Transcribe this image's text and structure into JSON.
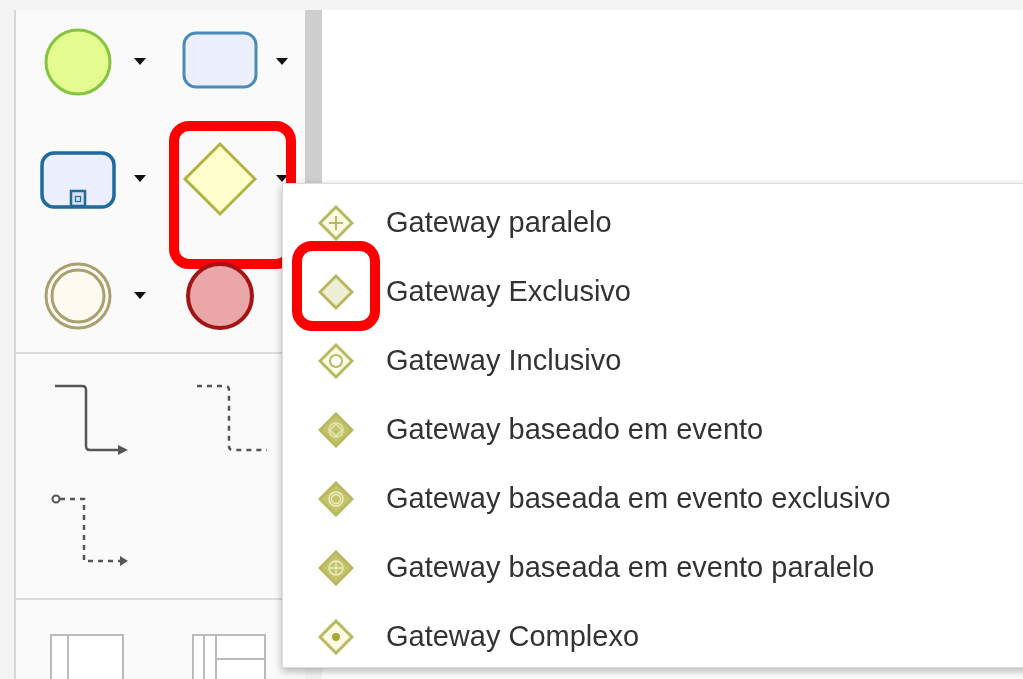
{
  "palette": {
    "sections": [
      {
        "tools": [
          {
            "kind": "start-event",
            "has_menu": true
          },
          {
            "kind": "task",
            "has_menu": true
          },
          {
            "kind": "subprocess",
            "has_menu": true
          },
          {
            "kind": "gateway",
            "has_menu": true,
            "highlighted": true
          },
          {
            "kind": "intermediate-event",
            "has_menu": true
          },
          {
            "kind": "end-event"
          }
        ]
      },
      {
        "tools": [
          {
            "kind": "sequence-flow"
          },
          {
            "kind": "message-flow"
          },
          {
            "kind": "association"
          }
        ]
      },
      {
        "tools": [
          {
            "kind": "pool"
          },
          {
            "kind": "lanes"
          }
        ]
      }
    ]
  },
  "menu": {
    "items": [
      {
        "label": "Gateway paralelo",
        "kind": "parallel"
      },
      {
        "label": "Gateway Exclusivo",
        "kind": "exclusive",
        "highlighted": true
      },
      {
        "label": "Gateway Inclusivo",
        "kind": "inclusive"
      },
      {
        "label": "Gateway baseado em evento",
        "kind": "event-based"
      },
      {
        "label": "Gateway baseada em evento exclusivo",
        "kind": "exclusive-event"
      },
      {
        "label": "Gateway baseada em evento paralelo",
        "kind": "parallel-event"
      },
      {
        "label": "Gateway Complexo",
        "kind": "complex"
      }
    ]
  }
}
